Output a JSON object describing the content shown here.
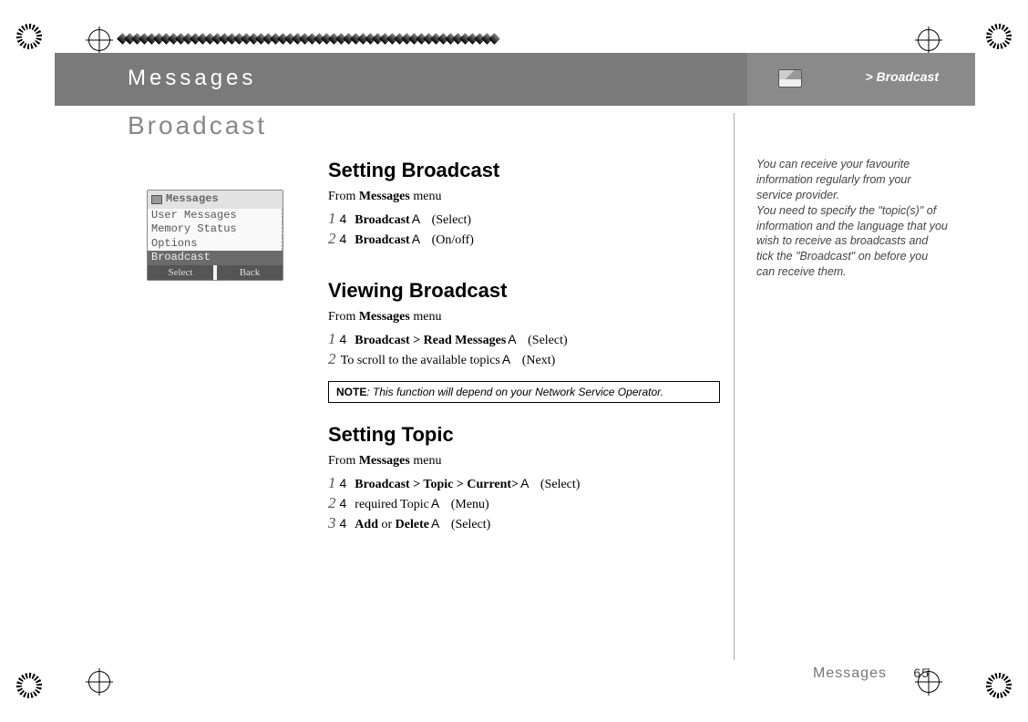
{
  "header": {
    "chapter": "Messages",
    "breadcrumb": "> Broadcast"
  },
  "section_title": "Broadcast",
  "phone": {
    "title": "Messages",
    "items": [
      "User Messages",
      "Memory Status",
      "Options"
    ],
    "selected": "Broadcast",
    "softkeys": {
      "left": "Select",
      "right": "Back"
    }
  },
  "sections": {
    "setting_broadcast": {
      "heading": "Setting Broadcast",
      "from_prefix": "From ",
      "from_menu": "Messages",
      "from_suffix": " menu",
      "steps": [
        {
          "num": "1",
          "arrow": "4",
          "bold": "Broadcast",
          "sym": "A",
          "action": "(Select)"
        },
        {
          "num": "2",
          "arrow": "4",
          "bold": "Broadcast",
          "sym": "A",
          "action": "(On/off)"
        }
      ]
    },
    "viewing_broadcast": {
      "heading": "Viewing Broadcast",
      "from_prefix": "From ",
      "from_menu": "Messages",
      "from_suffix": " menu",
      "steps": [
        {
          "num": "1",
          "arrow": "4",
          "bold": "Broadcast > Read Messages",
          "sym": "A",
          "action": "(Select)"
        },
        {
          "num": "2",
          "arrow": "",
          "plain": " To scroll to the available topics",
          "sym": "A",
          "action": "(Next)"
        }
      ],
      "note_label": "NOTE",
      "note_text": ": This function will depend on your Network Service Operator."
    },
    "setting_topic": {
      "heading": "Setting Topic",
      "from_prefix": "From ",
      "from_menu": "Messages",
      "from_suffix": " menu",
      "steps": [
        {
          "num": "1",
          "arrow": "4",
          "bold": "Broadcast > Topic > Current>",
          "sym": "A",
          "action": "(Select)"
        },
        {
          "num": "2",
          "arrow": "4",
          "plain": " required Topic",
          "sym": "A",
          "action": "(Menu)"
        },
        {
          "num": "3",
          "arrow": "4",
          "bold": "Add",
          "mid": " or ",
          "bold2": "Delete",
          "sym": "A",
          "action": "(Select)"
        }
      ]
    }
  },
  "side_note": "You can receive your favourite information regularly from your service provider.\nYou need to specify the \"topic(s)\" of information and the language that you wish to receive as broadcasts and tick the \"Broadcast\" on before you can receive them.",
  "footer": {
    "chapter": "Messages",
    "page": "65"
  }
}
